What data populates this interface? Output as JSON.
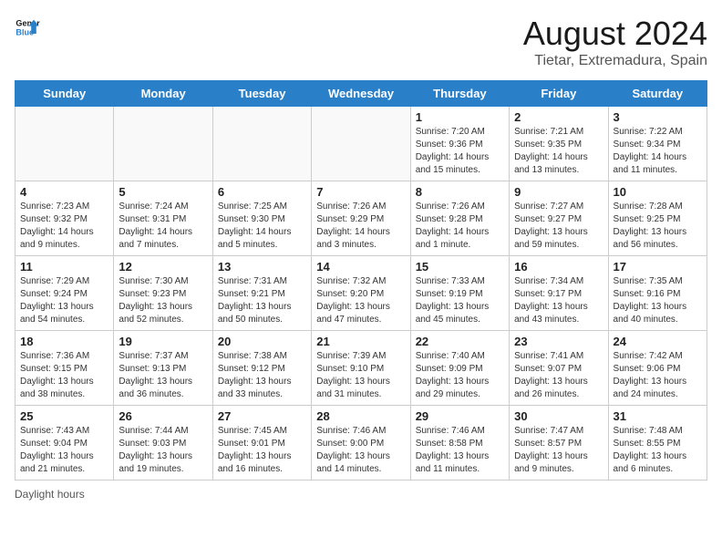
{
  "header": {
    "logo_line1": "General",
    "logo_line2": "Blue",
    "title": "August 2024",
    "subtitle": "Tietar, Extremadura, Spain"
  },
  "days_of_week": [
    "Sunday",
    "Monday",
    "Tuesday",
    "Wednesday",
    "Thursday",
    "Friday",
    "Saturday"
  ],
  "weeks": [
    [
      {
        "day": "",
        "info": ""
      },
      {
        "day": "",
        "info": ""
      },
      {
        "day": "",
        "info": ""
      },
      {
        "day": "",
        "info": ""
      },
      {
        "day": "1",
        "info": "Sunrise: 7:20 AM\nSunset: 9:36 PM\nDaylight: 14 hours and 15 minutes."
      },
      {
        "day": "2",
        "info": "Sunrise: 7:21 AM\nSunset: 9:35 PM\nDaylight: 14 hours and 13 minutes."
      },
      {
        "day": "3",
        "info": "Sunrise: 7:22 AM\nSunset: 9:34 PM\nDaylight: 14 hours and 11 minutes."
      }
    ],
    [
      {
        "day": "4",
        "info": "Sunrise: 7:23 AM\nSunset: 9:32 PM\nDaylight: 14 hours and 9 minutes."
      },
      {
        "day": "5",
        "info": "Sunrise: 7:24 AM\nSunset: 9:31 PM\nDaylight: 14 hours and 7 minutes."
      },
      {
        "day": "6",
        "info": "Sunrise: 7:25 AM\nSunset: 9:30 PM\nDaylight: 14 hours and 5 minutes."
      },
      {
        "day": "7",
        "info": "Sunrise: 7:26 AM\nSunset: 9:29 PM\nDaylight: 14 hours and 3 minutes."
      },
      {
        "day": "8",
        "info": "Sunrise: 7:26 AM\nSunset: 9:28 PM\nDaylight: 14 hours and 1 minute."
      },
      {
        "day": "9",
        "info": "Sunrise: 7:27 AM\nSunset: 9:27 PM\nDaylight: 13 hours and 59 minutes."
      },
      {
        "day": "10",
        "info": "Sunrise: 7:28 AM\nSunset: 9:25 PM\nDaylight: 13 hours and 56 minutes."
      }
    ],
    [
      {
        "day": "11",
        "info": "Sunrise: 7:29 AM\nSunset: 9:24 PM\nDaylight: 13 hours and 54 minutes."
      },
      {
        "day": "12",
        "info": "Sunrise: 7:30 AM\nSunset: 9:23 PM\nDaylight: 13 hours and 52 minutes."
      },
      {
        "day": "13",
        "info": "Sunrise: 7:31 AM\nSunset: 9:21 PM\nDaylight: 13 hours and 50 minutes."
      },
      {
        "day": "14",
        "info": "Sunrise: 7:32 AM\nSunset: 9:20 PM\nDaylight: 13 hours and 47 minutes."
      },
      {
        "day": "15",
        "info": "Sunrise: 7:33 AM\nSunset: 9:19 PM\nDaylight: 13 hours and 45 minutes."
      },
      {
        "day": "16",
        "info": "Sunrise: 7:34 AM\nSunset: 9:17 PM\nDaylight: 13 hours and 43 minutes."
      },
      {
        "day": "17",
        "info": "Sunrise: 7:35 AM\nSunset: 9:16 PM\nDaylight: 13 hours and 40 minutes."
      }
    ],
    [
      {
        "day": "18",
        "info": "Sunrise: 7:36 AM\nSunset: 9:15 PM\nDaylight: 13 hours and 38 minutes."
      },
      {
        "day": "19",
        "info": "Sunrise: 7:37 AM\nSunset: 9:13 PM\nDaylight: 13 hours and 36 minutes."
      },
      {
        "day": "20",
        "info": "Sunrise: 7:38 AM\nSunset: 9:12 PM\nDaylight: 13 hours and 33 minutes."
      },
      {
        "day": "21",
        "info": "Sunrise: 7:39 AM\nSunset: 9:10 PM\nDaylight: 13 hours and 31 minutes."
      },
      {
        "day": "22",
        "info": "Sunrise: 7:40 AM\nSunset: 9:09 PM\nDaylight: 13 hours and 29 minutes."
      },
      {
        "day": "23",
        "info": "Sunrise: 7:41 AM\nSunset: 9:07 PM\nDaylight: 13 hours and 26 minutes."
      },
      {
        "day": "24",
        "info": "Sunrise: 7:42 AM\nSunset: 9:06 PM\nDaylight: 13 hours and 24 minutes."
      }
    ],
    [
      {
        "day": "25",
        "info": "Sunrise: 7:43 AM\nSunset: 9:04 PM\nDaylight: 13 hours and 21 minutes."
      },
      {
        "day": "26",
        "info": "Sunrise: 7:44 AM\nSunset: 9:03 PM\nDaylight: 13 hours and 19 minutes."
      },
      {
        "day": "27",
        "info": "Sunrise: 7:45 AM\nSunset: 9:01 PM\nDaylight: 13 hours and 16 minutes."
      },
      {
        "day": "28",
        "info": "Sunrise: 7:46 AM\nSunset: 9:00 PM\nDaylight: 13 hours and 14 minutes."
      },
      {
        "day": "29",
        "info": "Sunrise: 7:46 AM\nSunset: 8:58 PM\nDaylight: 13 hours and 11 minutes."
      },
      {
        "day": "30",
        "info": "Sunrise: 7:47 AM\nSunset: 8:57 PM\nDaylight: 13 hours and 9 minutes."
      },
      {
        "day": "31",
        "info": "Sunrise: 7:48 AM\nSunset: 8:55 PM\nDaylight: 13 hours and 6 minutes."
      }
    ]
  ],
  "footer": {
    "label": "Daylight hours"
  }
}
